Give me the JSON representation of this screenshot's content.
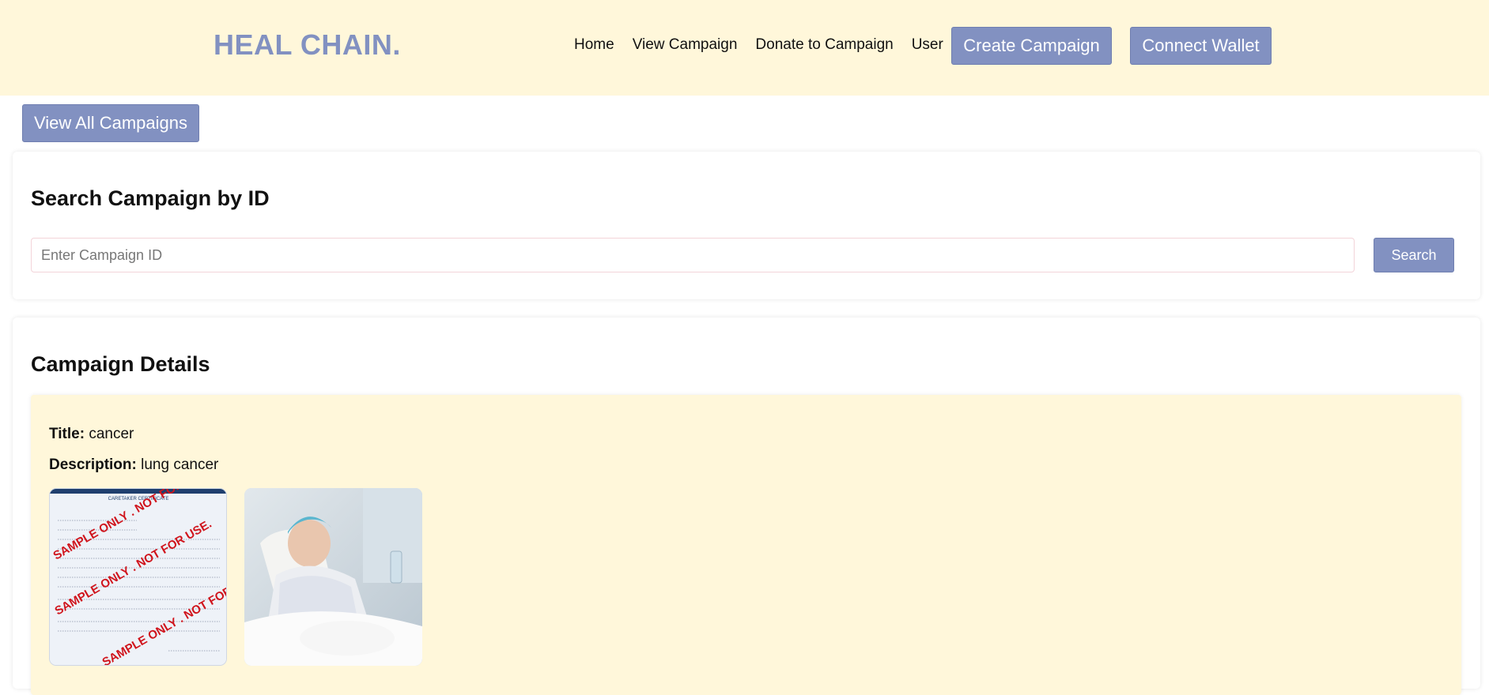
{
  "header": {
    "brand": "HEAL CHAIN.",
    "nav": [
      "Home",
      "View Campaign",
      "Donate to Campaign",
      "User"
    ],
    "create_label": "Create Campaign",
    "wallet_label": "Connect Wallet"
  },
  "view_all_label": "View All Campaigns",
  "search": {
    "heading": "Search Campaign by ID",
    "placeholder": "Enter Campaign ID",
    "value": "",
    "button_label": "Search"
  },
  "details": {
    "heading": "Campaign Details",
    "title_label": "Title:",
    "title_value": "cancer",
    "description_label": "Description:",
    "description_value": "lung cancer",
    "images": [
      {
        "name": "certificate-sample-image",
        "watermark": "SAMPLE ONLY . NOT FOR USE.",
        "doc_title": "CARETAKER CERTIFICATE"
      },
      {
        "name": "patient-in-hospital-bed-image"
      }
    ]
  },
  "colors": {
    "accent": "#8291c1",
    "header_bg": "#fff7da",
    "watermark": "#d0141c"
  }
}
